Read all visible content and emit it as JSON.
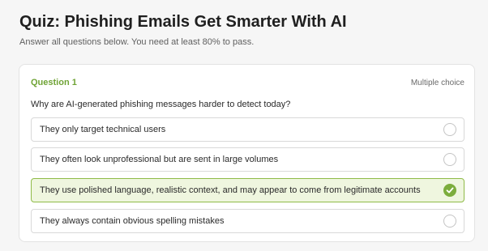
{
  "header": {
    "title": "Quiz: Phishing Emails Get Smarter With AI",
    "subtitle": "Answer all questions below. You need at least 80% to pass."
  },
  "question": {
    "label": "Question 1",
    "type": "Multiple choice",
    "text": "Why are AI-generated phishing messages harder to detect today?",
    "options": [
      {
        "text": "They only target technical users",
        "selected": false
      },
      {
        "text": "They often look unprofessional but are sent in large volumes",
        "selected": false
      },
      {
        "text": "They use polished language, realistic context, and may appear to come from legitimate accounts",
        "selected": true
      },
      {
        "text": "They always contain obvious spelling mistakes",
        "selected": false
      }
    ]
  },
  "colors": {
    "accent": "#7cad3c",
    "selected_background": "#eff6df",
    "selected_border": "#8fbb48"
  },
  "icons": {
    "selected_marker": "check-icon"
  }
}
